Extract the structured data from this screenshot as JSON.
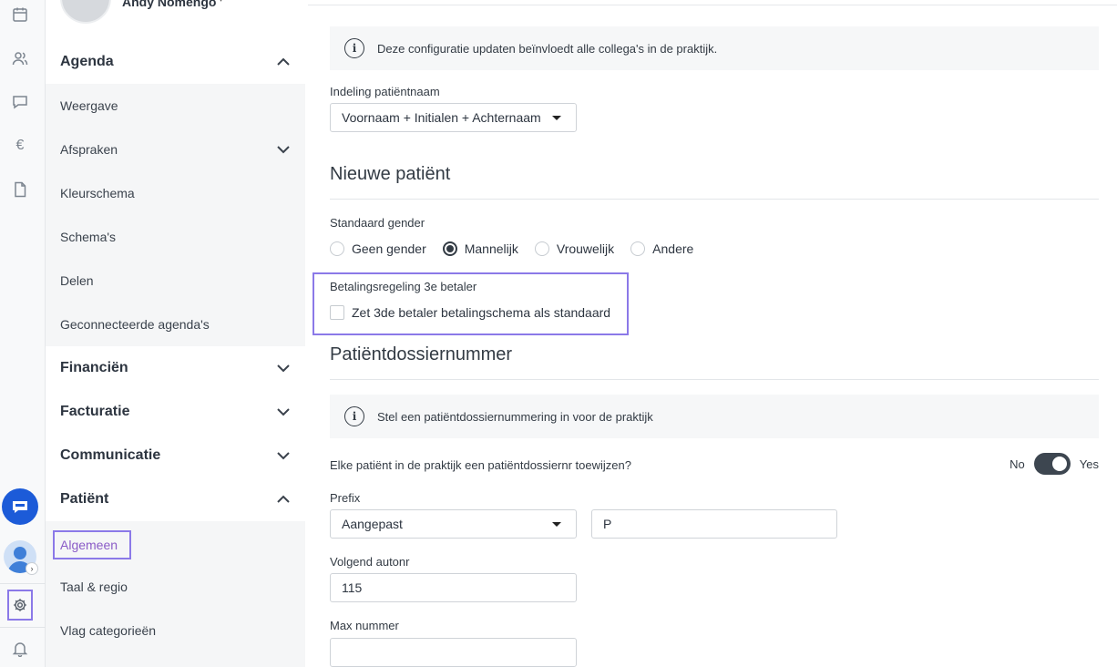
{
  "user": {
    "name": "Andy Nomengo"
  },
  "rail": {
    "icons": [
      "calendar-icon",
      "users-icon",
      "chat-icon",
      "euro-icon",
      "document-icon"
    ],
    "euro_glyph": "€",
    "avatar_chevron": "›"
  },
  "sidebar": {
    "sections": [
      {
        "label": "Agenda",
        "expanded": true
      },
      {
        "label": "Financiën",
        "expanded": false
      },
      {
        "label": "Facturatie",
        "expanded": false
      },
      {
        "label": "Communicatie",
        "expanded": false
      },
      {
        "label": "Patiënt",
        "expanded": true
      }
    ],
    "agenda_items": [
      "Weergave",
      "Afspraken",
      "Kleurschema",
      "Schema's",
      "Delen",
      "Geconnecteerde agenda's"
    ],
    "patient_items": [
      "Algemeen",
      "Taal & regio",
      "Vlag categorieën"
    ],
    "active_item": "Algemeen"
  },
  "main": {
    "info_config": "Deze configuratie updaten beïnvloedt alle collega's in de praktijk.",
    "name_format_label": "Indeling patiëntnaam",
    "name_format_value": "Voornaam + Initialen + Achternaam",
    "new_patient_heading": "Nieuwe patiënt",
    "gender_label": "Standaard gender",
    "gender_options": [
      "Geen gender",
      "Mannelijk",
      "Vrouwelijk",
      "Andere"
    ],
    "gender_selected": "Mannelijk",
    "third_payer_label": "Betalingsregeling 3e betaler",
    "third_payer_checkbox": "Zet 3de betaler betalingschema als standaard",
    "dossier_heading": "Patiëntdossiernummer",
    "info_dossier": "Stel een patiëntdossiernummering in voor de praktijk",
    "assign_question": "Elke patiënt in de praktijk een patiëntdossiernr toewijzen?",
    "toggle_no": "No",
    "toggle_yes": "Yes",
    "toggle_value": "Yes",
    "prefix_label": "Prefix",
    "prefix_type": "Aangepast",
    "prefix_value": "P",
    "next_autonr_label": "Volgend autonr",
    "next_autonr_value": "115",
    "max_number_label": "Max nummer",
    "max_number_value": "",
    "info_glyph": "i"
  }
}
